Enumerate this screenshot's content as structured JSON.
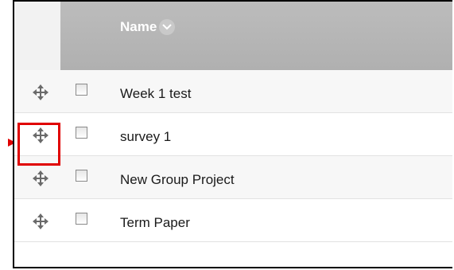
{
  "header": {
    "column_label": "Name",
    "sort_icon": "chevron-down-icon"
  },
  "rows": [
    {
      "label": "Week 1 test",
      "move_icon": "move-arrows-icon",
      "checked": false
    },
    {
      "label": "survey 1",
      "move_icon": "move-arrows-icon",
      "checked": false,
      "highlighted": true
    },
    {
      "label": "New Group Project",
      "move_icon": "move-arrows-icon",
      "checked": false
    },
    {
      "label": "Term Paper",
      "move_icon": "move-arrows-icon",
      "checked": false
    }
  ],
  "colors": {
    "header_bg": "#b5b5b5",
    "highlight": "#e00000",
    "row_alt_bg": "#f7f7f7"
  }
}
